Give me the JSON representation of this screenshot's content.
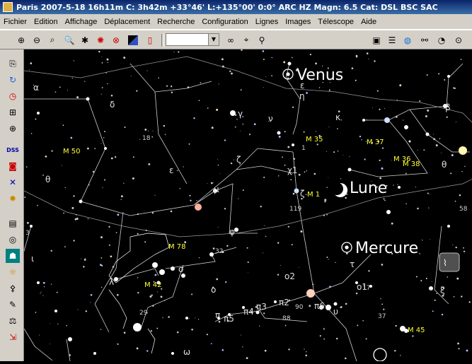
{
  "window": {
    "title": "Paris 2007-5-18  16h11m C:  3h42m +33°46' L:+135°00' 0:0° ARC HZ  Magn: 6.5 Cat: DSL BSC SAC"
  },
  "menu": [
    "Fichier",
    "Edition",
    "Affichage",
    "Déplacement",
    "Recherche",
    "Configuration",
    "Lignes",
    "Images",
    "Télescope",
    "Aide"
  ],
  "toolbar_icons": [
    "zoom-in-icon",
    "zoom-out-icon",
    "zoom-fit-icon",
    "find-icon",
    "target-icon",
    "nova-icon",
    "marker-icon",
    "color-icon",
    "page-icon",
    "binoculars-icon",
    "telescope-icon",
    "zoom-glass-icon",
    "save-icon",
    "list-icon",
    "globe-icon",
    "satellite-icon",
    "gauge-icon",
    "dial-icon"
  ],
  "combo_value": "",
  "left_icons": [
    "copy-icon",
    "refresh-icon",
    "clock-icon",
    "network-icon",
    "globe-grid-icon",
    "dss-icon",
    "camera-icon",
    "dna-icon",
    "bulb-icon",
    "table-icon",
    "compass-icon",
    "person-icon",
    "sun-icon",
    "satellite-small-icon",
    "notes-icon",
    "scale-icon",
    "exit-icon"
  ],
  "sky": {
    "bodies": [
      {
        "name": "Venus"
      },
      {
        "name": "Lune"
      },
      {
        "name": "Mercure"
      }
    ],
    "messier": [
      "M 50",
      "M 35",
      "M 37",
      "M 36",
      "M 38",
      "M 1",
      "M 78",
      "M 42",
      "M 45"
    ],
    "greek": [
      "α",
      "δ",
      "θ",
      "γ",
      "ε",
      "μ",
      "ζ",
      "ν",
      "η",
      "κ",
      "β",
      "λ",
      "ι",
      "ο",
      "π",
      "τ",
      "ξ",
      "σ",
      "φ",
      "ω",
      "χ1",
      "ζ",
      "π2",
      "π3",
      "π4",
      "π5",
      "π6",
      "ο2",
      "ο1",
      "υ",
      "θ",
      "ε"
    ],
    "numbers": [
      "18",
      "1",
      "119",
      "32",
      "29",
      "90",
      "88",
      "37",
      "58",
      "17",
      "3"
    ]
  }
}
